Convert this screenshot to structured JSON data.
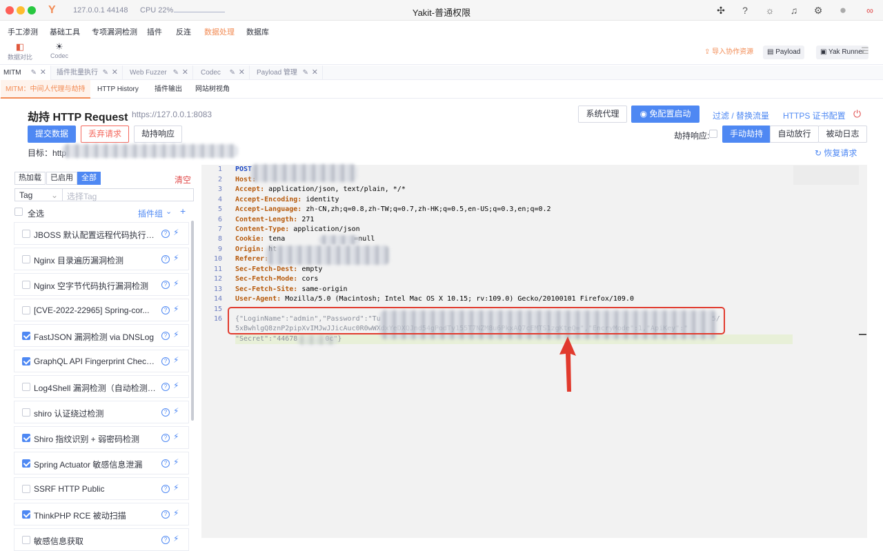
{
  "titlebar": {
    "ip": "127.0.0.1 44148",
    "cpu": "CPU 22%",
    "title": "Yakit-普通权限"
  },
  "menu": {
    "items": [
      "手工渗测",
      "基础工具",
      "专项漏洞检测",
      "插件",
      "反连",
      "数据处理",
      "数据库"
    ],
    "import": "导入协作资源",
    "payload": "Payload",
    "yak_runner": "Yak Runner"
  },
  "tools": {
    "compare": "数据对比",
    "codec": "Codec"
  },
  "tabs": [
    {
      "label": "MITM"
    },
    {
      "label": "插件批量执行"
    },
    {
      "label": "Web Fuzzer"
    },
    {
      "label": "Codec"
    },
    {
      "label": "Payload 管理"
    }
  ],
  "subtabs": [
    "MITM：中间人代理与劫持",
    "HTTP History",
    "插件输出",
    "网站树视角"
  ],
  "header": {
    "title": "劫持 HTTP Request",
    "url": "https://127.0.0.1:8083",
    "system_proxy": "系统代理",
    "free_config": "免配置启动",
    "filter": "过滤 / 替换流量",
    "https_cert": "HTTPS 证书配置"
  },
  "actions": {
    "submit": "提交数据",
    "discard": "丢弃请求",
    "hijack_resp": "劫持响应",
    "hijack_resp_label": "劫持响应:",
    "manual": "手动劫持",
    "auto": "自动放行",
    "passive_log": "被动日志",
    "target_label": "目标：",
    "target_prefix": "http",
    "restore": "恢复请求"
  },
  "plugins_panel": {
    "segments": [
      "热加载",
      "已启用",
      "全部"
    ],
    "clear": "清空",
    "tag": "Tag",
    "tag_placeholder": "选择Tag",
    "select_all": "全选",
    "group": "插件组",
    "items": [
      {
        "name": "JBOSS 默认配置远程代码执行 漏...",
        "checked": false
      },
      {
        "name": "Nginx 目录遍历漏洞检测",
        "checked": false
      },
      {
        "name": "Nginx 空字节代码执行漏洞检测",
        "checked": false
      },
      {
        "name": "[CVE-2022-22965] Spring-cor...",
        "checked": false
      },
      {
        "name": "FastJSON 漏洞检测 via DNSLog",
        "checked": true
      },
      {
        "name": "GraphQL API Fingerprint Checki...",
        "checked": true
      },
      {
        "name": "Log4Shell 漏洞检测（自动检测版...",
        "checked": false
      },
      {
        "name": "shiro 认证绕过检测",
        "checked": false
      },
      {
        "name": "Shiro 指纹识别 + 弱密码检测",
        "checked": true
      },
      {
        "name": "Spring Actuator 敏感信息泄漏",
        "checked": true
      },
      {
        "name": "SSRF HTTP Public",
        "checked": false
      },
      {
        "name": "ThinkPHP RCE 被动扫描",
        "checked": true
      },
      {
        "name": "敏感信息获取",
        "checked": false
      }
    ]
  },
  "request": {
    "line_numbers": [
      "1",
      "2",
      "3",
      "4",
      "5",
      "6",
      "7",
      "8",
      "9",
      "10",
      "11",
      "12",
      "13",
      "14",
      "15",
      "16"
    ],
    "l1": "POST",
    "l2k": "Host:",
    "l3k": "Accept:",
    "l3v": " application/json, text/plain, */*",
    "l4k": "Accept-Encoding:",
    "l4v": " identity",
    "l5k": "Accept-Language:",
    "l5v": " zh-CN,zh;q=0.8,zh-TW;q=0.7,zh-HK;q=0.5,en-US;q=0.3,en;q=0.2",
    "l6k": "Content-Length:",
    "l6v": " 271",
    "l7k": "Content-Type:",
    "l7v": " application/json",
    "l8k": "Cookie:",
    "l8v": " tena",
    "l8v2": "=null",
    "l9k": "Origin:",
    "l9v": " ht",
    "l10k": "Referer:",
    "l11k": "Sec-Fetch-Dest:",
    "l11v": " empty",
    "l12k": "Sec-Fetch-Mode:",
    "l12v": " cors",
    "l13k": "Sec-Fetch-Site:",
    "l13v": " same-origin",
    "l14k": "User-Agent:",
    "l14v": " Mozilla/5.0 (Macintosh; Intel Mac OS X 10.15; rv:109.0) Gecko/20100101 Firefox/109.0",
    "l16a": "{\"LoginName\":\"admin\",\"Password\":\"Tu",
    "l16b": "5/",
    "l16c": "5xBwhlgQ8znP2pipXvIMJwJJicAuc0R0wWXdxYeDXQJnd54gPodTy155T7NZM8u6PkxAQ7cEMTS1zgKteQ=\",\"EncryMode\":1,\"ApiKey\":\"",
    "l16d": "\"Secret\":\"44678",
    "l16e": "0c\"}"
  }
}
